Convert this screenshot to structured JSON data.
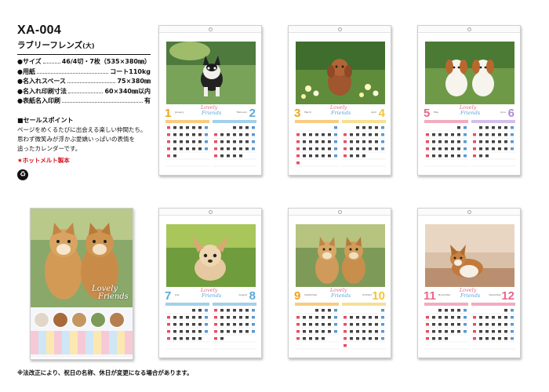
{
  "product": {
    "code": "XA-004",
    "name": "ラブリーフレンズ",
    "size_tag": "(大)"
  },
  "specs": [
    {
      "label": "●サイズ",
      "value": "46/4切・7枚（535×380㎜）"
    },
    {
      "label": "●用紙",
      "value": "コート110kg"
    },
    {
      "label": "●名入れスペース",
      "value": "75×380㎜"
    },
    {
      "label": "●名入れ印刷寸法",
      "value": "60×340㎜以内"
    },
    {
      "label": "●表紙名入印刷",
      "value": "有"
    }
  ],
  "selling_point": {
    "title": "■セールスポイント",
    "lines": [
      "ページをめくるたびに出会える楽しい仲間たち。",
      "思わず微笑みが浮かぶ愛嬌いっぱいの表情を",
      "追ったカレンダーです。"
    ]
  },
  "hotmelt": "★ホットメルト製本",
  "recycle_icon": "recycle-icon",
  "footnote": "※法改正により、祝日の名称、休日が変更になる場合があります。",
  "cover": {
    "logo_line1": "Lovely",
    "logo_line2": "Friends"
  },
  "colors": {
    "jan": "#f3a21a",
    "feb": "#5aa9d8",
    "mar": "#f3a21a",
    "apr": "#f0c63a",
    "may": "#e8688c",
    "jun": "#b38ad9",
    "jul": "#5aa9d8",
    "aug": "#5aa9d8",
    "sep": "#f3a21a",
    "oct": "#f0c63a",
    "nov": "#e8688c",
    "dec": "#e8688c",
    "sunday": "#e0304a",
    "saturday": "#3f86c8",
    "weekday": "#222222"
  },
  "pages": [
    {
      "left_month": "1",
      "right_month": "2",
      "left_name": "January",
      "right_name": "February",
      "photo": "french-bulldog"
    },
    {
      "left_month": "3",
      "right_month": "4",
      "left_name": "March",
      "right_name": "April",
      "photo": "toy-poodle"
    },
    {
      "left_month": "5",
      "right_month": "6",
      "left_name": "May",
      "right_name": "June",
      "photo": "two-puppies"
    },
    {
      "left_month": "7",
      "right_month": "8",
      "left_name": "July",
      "right_name": "August",
      "photo": "chihuahua"
    },
    {
      "left_month": "9",
      "right_month": "10",
      "left_name": "September",
      "right_name": "October",
      "photo": "shiba-pair"
    },
    {
      "left_month": "11",
      "right_month": "12",
      "left_name": "November",
      "right_name": "December",
      "photo": "corgi"
    }
  ]
}
